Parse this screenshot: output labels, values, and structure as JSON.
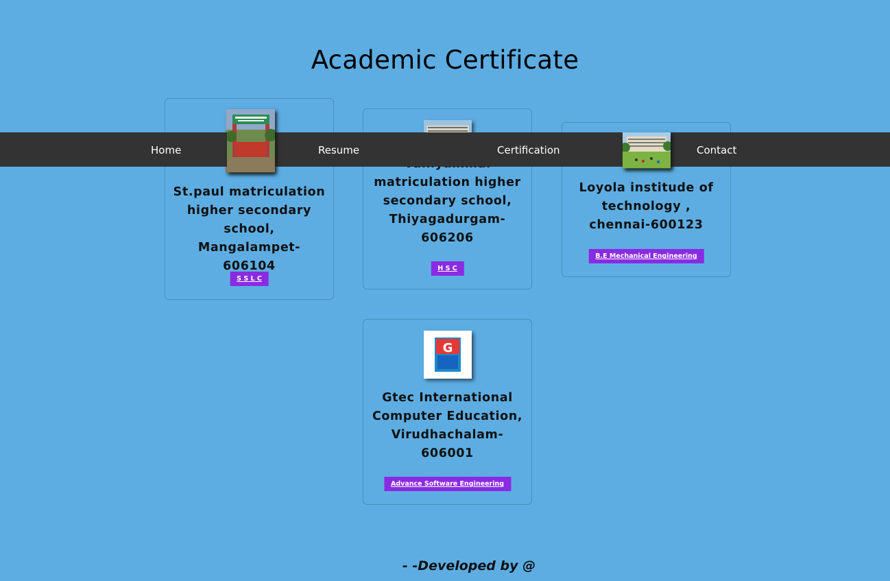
{
  "page": {
    "title": "Academic Certificate",
    "background": "#5dade2"
  },
  "nav": {
    "background": "#333333",
    "items": [
      {
        "label": "Home"
      },
      {
        "label": "Resume"
      },
      {
        "label": "Certification"
      },
      {
        "label": "Contact"
      }
    ]
  },
  "cards": [
    {
      "name": "St.paul matriculation higher secondary school, Mangalampet-606104",
      "button": "S S L C",
      "image_icon": "school-gate-photo"
    },
    {
      "name": "Valliyammal matriculation higher secondary school, Thiyagadurgam-606206",
      "button": "H S C",
      "image_icon": "school-building-photo"
    },
    {
      "name": "Loyola institude of technology , chennai-600123",
      "button": "B.E Mechanical Engineering",
      "image_icon": "college-campus-photo"
    },
    {
      "name": "Gtec International Computer Education, Virudhachalam-606001",
      "button": "Advance Software Engineering",
      "image_icon": "gtec-logo"
    }
  ],
  "footer": {
    "text": "- -Developed by @"
  },
  "colors": {
    "button": "#8a2be2",
    "card_border": "#4a8fbd"
  }
}
